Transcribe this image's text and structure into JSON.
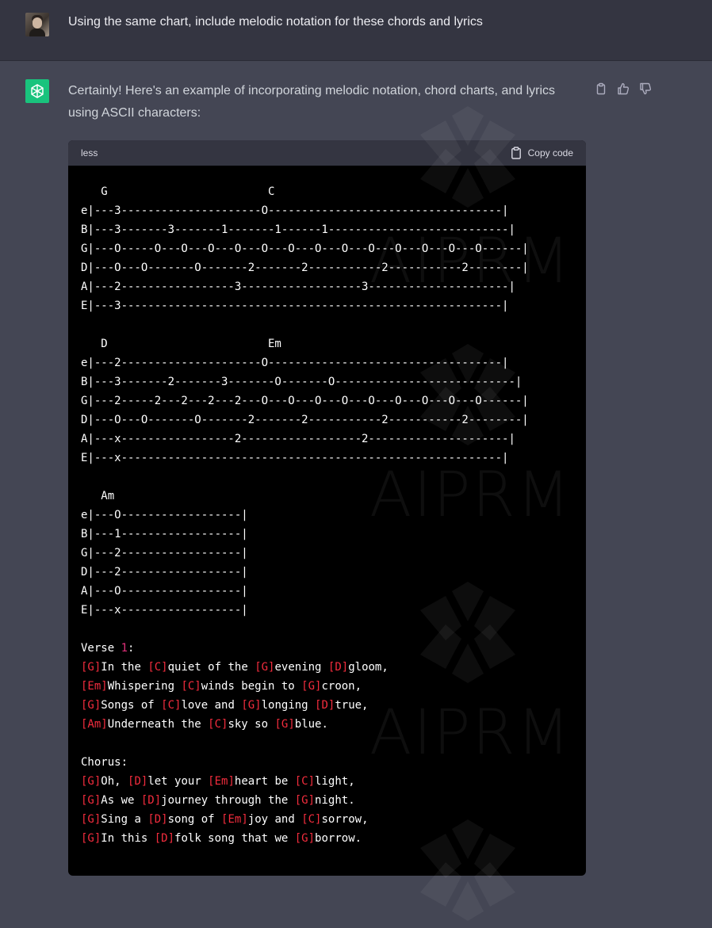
{
  "user_message": {
    "text": "Using the same chart, include melodic notation for these chords and lyrics"
  },
  "assistant_message": {
    "intro": "Certainly! Here's an example of incorporating melodic notation, chord charts, and lyrics using ASCII characters:",
    "code_block": {
      "language": "less",
      "copy_label": "Copy code",
      "tab_lines": [
        "   G                        C",
        "e|---3---------------------O-----------------------------------|",
        "B|---3-------3-------1-------1------1---------------------------|",
        "G|---O-----O---O---O---O---O---O---O---O---O---O---O---O---O------|",
        "D|---O---O-------O-------2-------2-----------2-----------2--------|",
        "A|---2-----------------3------------------3---------------------|",
        "E|---3---------------------------------------------------------|",
        "",
        "   D                        Em",
        "e|---2---------------------O-----------------------------------|",
        "B|---3-------2-------3-------O-------O---------------------------|",
        "G|---2-----2---2---2---2---O---O---O---O---O---O---O---O---O------|",
        "D|---O---O-------O-------2-------2-----------2-----------2--------|",
        "A|---x-----------------2------------------2---------------------|",
        "E|---x---------------------------------------------------------|",
        "",
        "   Am",
        "e|---O------------------|",
        "B|---1------------------|",
        "G|---2------------------|",
        "D|---2------------------|",
        "A|---O------------------|",
        "E|---x------------------|",
        ""
      ],
      "verse_label": "Verse ",
      "verse_number": "1",
      "verse_colon": ":",
      "verse_lines": [
        [
          {
            "t": "[G]",
            "c": true
          },
          {
            "t": "In the "
          },
          {
            "t": "[C]",
            "c": true
          },
          {
            "t": "quiet of the "
          },
          {
            "t": "[G]",
            "c": true
          },
          {
            "t": "evening "
          },
          {
            "t": "[D]",
            "c": true
          },
          {
            "t": "gloom,"
          }
        ],
        [
          {
            "t": "[Em]",
            "c": true
          },
          {
            "t": "Whispering "
          },
          {
            "t": "[C]",
            "c": true
          },
          {
            "t": "winds begin to "
          },
          {
            "t": "[G]",
            "c": true
          },
          {
            "t": "croon,"
          }
        ],
        [
          {
            "t": "[G]",
            "c": true
          },
          {
            "t": "Songs of "
          },
          {
            "t": "[C]",
            "c": true
          },
          {
            "t": "love and "
          },
          {
            "t": "[G]",
            "c": true
          },
          {
            "t": "longing "
          },
          {
            "t": "[D]",
            "c": true
          },
          {
            "t": "true,"
          }
        ],
        [
          {
            "t": "[Am]",
            "c": true
          },
          {
            "t": "Underneath the "
          },
          {
            "t": "[C]",
            "c": true
          },
          {
            "t": "sky so "
          },
          {
            "t": "[G]",
            "c": true
          },
          {
            "t": "blue."
          }
        ]
      ],
      "chorus_label": "Chorus:",
      "chorus_lines": [
        [
          {
            "t": "[G]",
            "c": true
          },
          {
            "t": "Oh, "
          },
          {
            "t": "[D]",
            "c": true
          },
          {
            "t": "let your "
          },
          {
            "t": "[Em]",
            "c": true
          },
          {
            "t": "heart be "
          },
          {
            "t": "[C]",
            "c": true
          },
          {
            "t": "light,"
          }
        ],
        [
          {
            "t": "[G]",
            "c": true
          },
          {
            "t": "As we "
          },
          {
            "t": "[D]",
            "c": true
          },
          {
            "t": "journey through the "
          },
          {
            "t": "[G]",
            "c": true
          },
          {
            "t": "night."
          }
        ],
        [
          {
            "t": "[G]",
            "c": true
          },
          {
            "t": "Sing a "
          },
          {
            "t": "[D]",
            "c": true
          },
          {
            "t": "song of "
          },
          {
            "t": "[Em]",
            "c": true
          },
          {
            "t": "joy and "
          },
          {
            "t": "[C]",
            "c": true
          },
          {
            "t": "sorrow,"
          }
        ],
        [
          {
            "t": "[G]",
            "c": true
          },
          {
            "t": "In this "
          },
          {
            "t": "[D]",
            "c": true
          },
          {
            "t": "folk song that we "
          },
          {
            "t": "[G]",
            "c": true
          },
          {
            "t": "borrow."
          }
        ]
      ]
    },
    "actions": [
      "clipboard-icon",
      "thumbs-up-icon",
      "thumbs-down-icon"
    ]
  },
  "watermark": {
    "text": "AIPRM"
  },
  "colors": {
    "page_bg": "#444654",
    "user_row_bg": "#343541",
    "bot_avatar": "#19c37d",
    "code_bg": "#000000",
    "chord_highlight": "#f22c3d"
  }
}
